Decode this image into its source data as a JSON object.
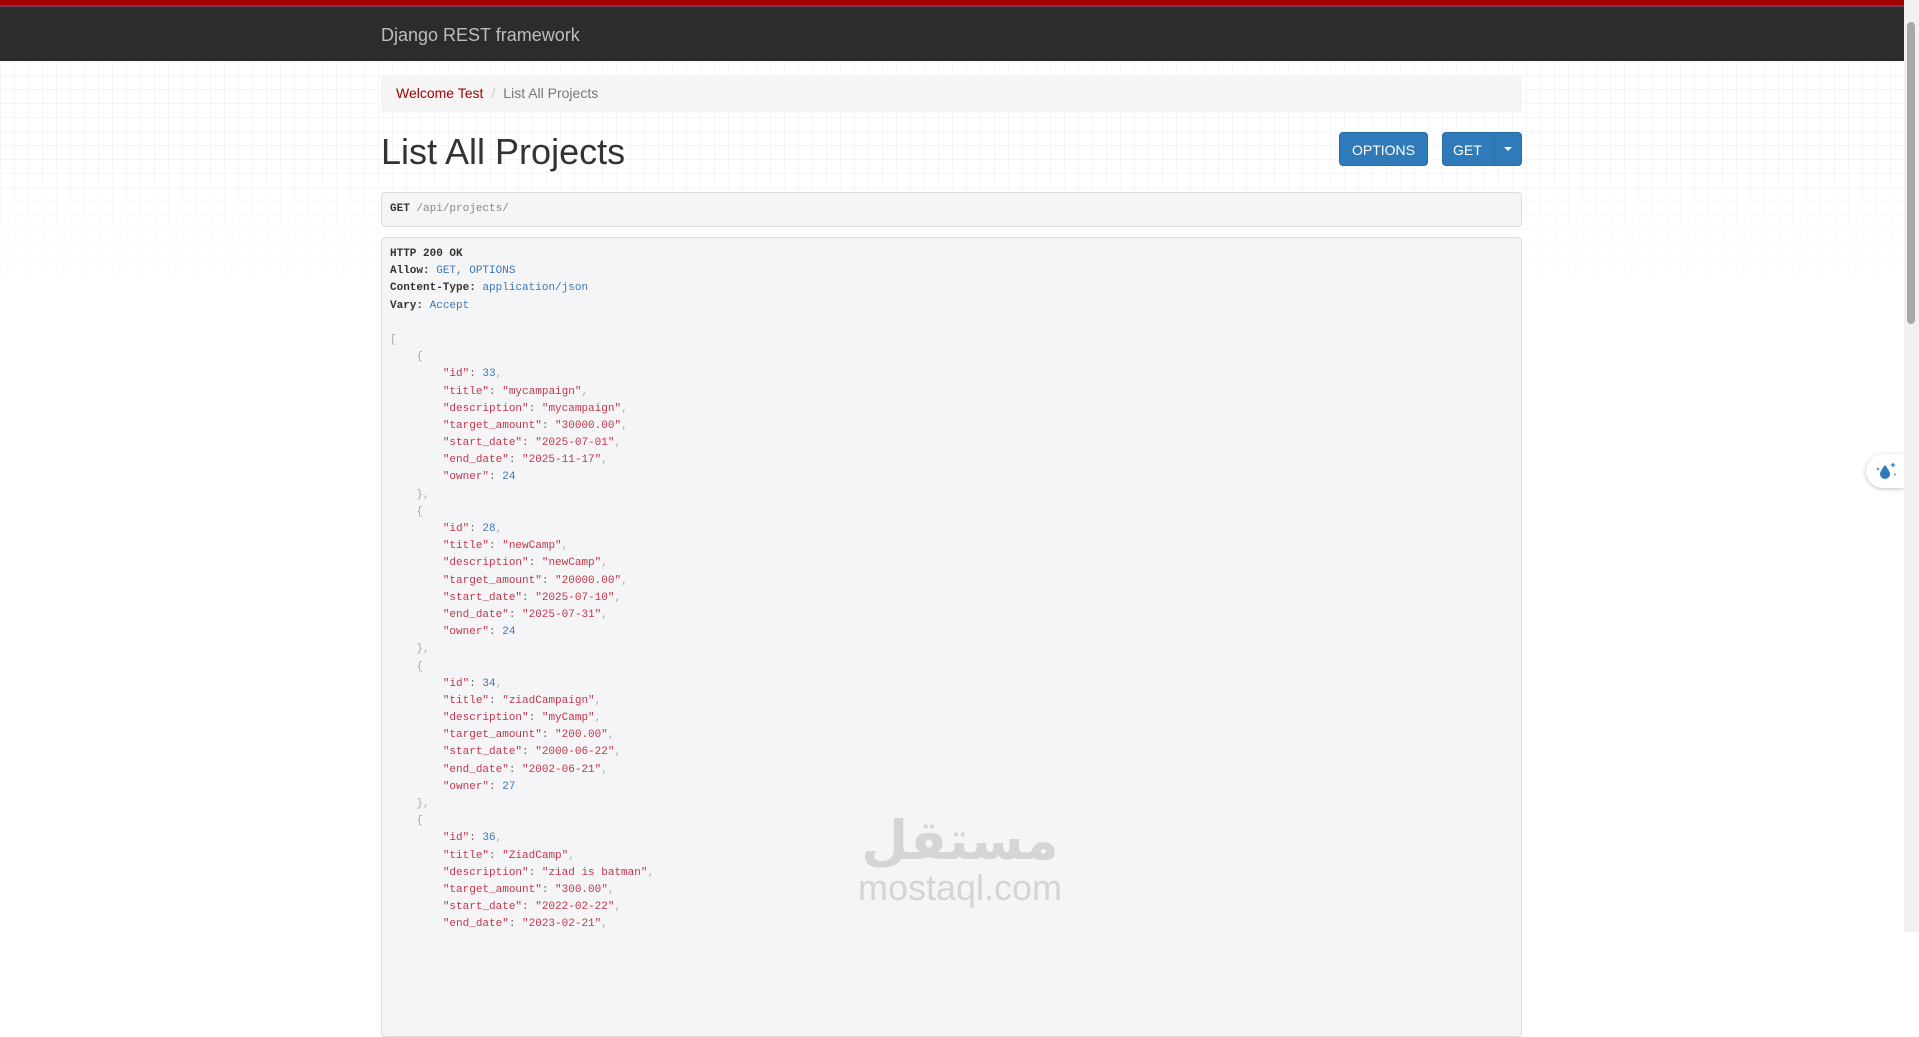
{
  "navbar": {
    "brand": "Django REST framework"
  },
  "breadcrumb": {
    "link_label": "Welcome Test",
    "separator": "/",
    "active_label": "List All Projects"
  },
  "page": {
    "title": "List All Projects"
  },
  "actions": {
    "options_label": "OPTIONS",
    "get_label": "GET"
  },
  "request": {
    "method": "GET",
    "path": "/api/projects/"
  },
  "response": {
    "status": "HTTP 200 OK",
    "headers": [
      {
        "key": "Allow:",
        "value": "GET, OPTIONS"
      },
      {
        "key": "Content-Type:",
        "value": "application/json"
      },
      {
        "key": "Vary:",
        "value": "Accept"
      }
    ],
    "projects": [
      {
        "id": "33",
        "title": "\"mycampaign\"",
        "description": "\"mycampaign\"",
        "target_amount": "\"30000.00\"",
        "start_date": "\"2025-07-01\"",
        "end_date": "\"2025-11-17\"",
        "owner": "24"
      },
      {
        "id": "28",
        "title": "\"newCamp\"",
        "description": "\"newCamp\"",
        "target_amount": "\"20000.00\"",
        "start_date": "\"2025-07-10\"",
        "end_date": "\"2025-07-31\"",
        "owner": "24"
      },
      {
        "id": "34",
        "title": "\"ziadCampaign\"",
        "description": "\"myCamp\"",
        "target_amount": "\"200.00\"",
        "start_date": "\"2000-06-22\"",
        "end_date": "\"2002-06-21\"",
        "owner": "27"
      },
      {
        "id": "36",
        "title": "\"ZiadCamp\"",
        "description": "\"ziad is batman\"",
        "target_amount": "\"300.00\"",
        "start_date": "\"2022-02-22\"",
        "end_date": "\"2023-02-21\"",
        "owner": ""
      }
    ],
    "keys": {
      "id": "\"id\"",
      "title": "\"title\"",
      "description": "\"description\"",
      "target_amount": "\"target_amount\"",
      "start_date": "\"start_date\"",
      "end_date": "\"end_date\"",
      "owner": "\"owner\""
    }
  },
  "watermark": {
    "arabic": "مستقل",
    "latin": "mostaql.com"
  },
  "colors": {
    "brand_red": "#a30000",
    "button_blue": "#2f7ab8",
    "navbar": "#2c2c2c"
  },
  "icons": {
    "widget": "water-drop-sparkle-icon"
  }
}
